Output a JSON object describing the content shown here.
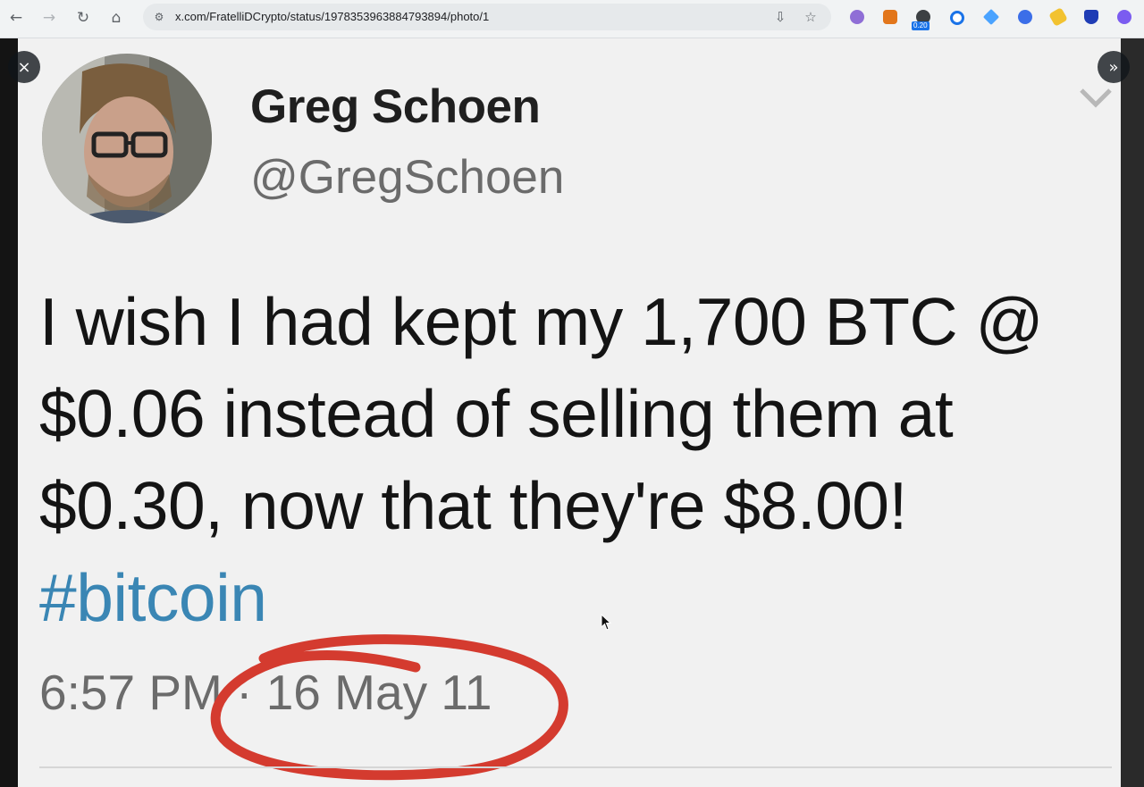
{
  "browser": {
    "url": "x.com/FratelliDCrypto/status/1978353963884793894/photo/1",
    "ext_badge": "0.20"
  },
  "viewer": {
    "close_icon": "×",
    "next_icon": "»"
  },
  "tweet": {
    "name": "Greg Schoen",
    "handle": "@GregSchoen",
    "text": "I wish I had kept my 1,700 BTC @ $0.06 instead of selling them at $0.30, now that they're $8.00! ",
    "hashtag": "#bitcoin",
    "time": "6:57 PM · 16 May 11"
  },
  "colors": {
    "hashtag": "#3a86b4",
    "circle": "#d43b2f"
  }
}
